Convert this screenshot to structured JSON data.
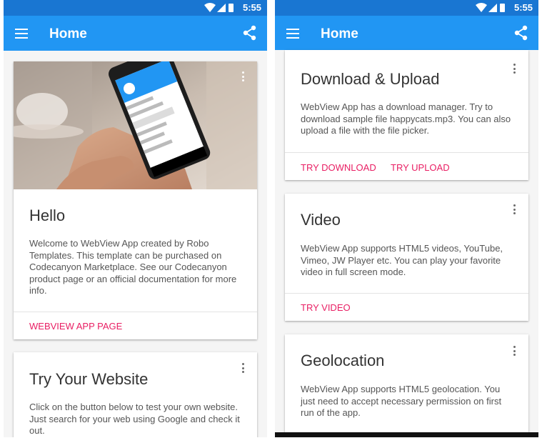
{
  "status_bar": {
    "time": "5:55"
  },
  "app_bar": {
    "title": "Home"
  },
  "cards": {
    "hello": {
      "title": "Hello",
      "body": "Welcome to WebView App created by Robo Templates. This template can be purchased on Codecanyon Marketplace. See our Codecanyon product page or an official documentation for more info.",
      "action": "WEBVIEW APP PAGE"
    },
    "website": {
      "title": "Try Your Website",
      "body": "Click on the button below to test your own website. Just search for your web using Google and check it out."
    },
    "download": {
      "title": "Download & Upload",
      "body": "WebView App has a download manager. Try to download sample file happycats.mp3. You can also upload a file with the file picker.",
      "action_download": "TRY DOWNLOAD",
      "action_upload": "TRY UPLOAD"
    },
    "video": {
      "title": "Video",
      "body": "WebView App supports HTML5 videos, YouTube, Vimeo, JW Player etc. You can play your favorite video in full screen mode.",
      "action": "TRY VIDEO"
    },
    "geolocation": {
      "title": "Geolocation",
      "body": "WebView App supports HTML5 geolocation. You just need to accept necessary permission on first run of the app."
    }
  },
  "colors": {
    "status_bar": "#1976d2",
    "app_bar": "#2196f3",
    "accent": "#e91e63"
  },
  "icons": [
    "menu-icon",
    "share-icon",
    "more-vert-icon",
    "wifi-icon",
    "signal-icon",
    "battery-icon"
  ]
}
